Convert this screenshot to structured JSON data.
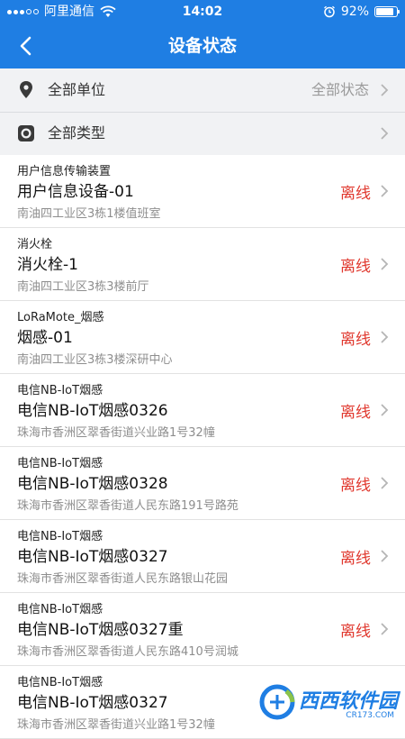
{
  "status_bar": {
    "carrier": "阿里通信",
    "time": "14:02",
    "battery_text": "92%",
    "battery_level": 0.92
  },
  "nav": {
    "title": "设备状态",
    "back_icon": "back-arrow-icon"
  },
  "filters": {
    "unit": {
      "label": "全部单位",
      "value": "全部状态",
      "icon": "location-pin-icon"
    },
    "type": {
      "label": "全部类型",
      "icon": "device-type-icon"
    }
  },
  "devices": [
    {
      "type": "用户信息传输装置",
      "name": "用户信息设备-01",
      "address": "南油四工业区3栋1楼值班室",
      "status": "离线"
    },
    {
      "type": "消火栓",
      "name": "消火栓-1",
      "address": "南油四工业区3栋3楼前厅",
      "status": "离线"
    },
    {
      "type": "LoRaMote_烟感",
      "name": "烟感-01",
      "address": "南油四工业区3栋3楼深研中心",
      "status": "离线"
    },
    {
      "type": "电信NB-IoT烟感",
      "name": "电信NB-IoT烟感0326",
      "address": "珠海市香洲区翠香街道兴业路1号32幢",
      "status": "离线"
    },
    {
      "type": "电信NB-IoT烟感",
      "name": "电信NB-IoT烟感0328",
      "address": "珠海市香洲区翠香街道人民东路191号路苑",
      "status": "离线"
    },
    {
      "type": "电信NB-IoT烟感",
      "name": "电信NB-IoT烟感0327",
      "address": "珠海市香洲区翠香街道人民东路银山花园",
      "status": "离线"
    },
    {
      "type": "电信NB-IoT烟感",
      "name": "电信NB-IoT烟感0327重",
      "address": "珠海市香洲区翠香街道人民东路410号润城",
      "status": "离线"
    },
    {
      "type": "电信NB-IoT烟感",
      "name": "电信NB-IoT烟感0327",
      "address": "珠海市香洲区翠香街道兴业路1号32幢",
      "status": ""
    }
  ],
  "watermark": {
    "text": "西西软件园",
    "sub": "CR173.COM"
  },
  "colors": {
    "primary": "#1f7ee3",
    "offline": "#e0382e",
    "filter_bg": "#f1f2f4"
  }
}
